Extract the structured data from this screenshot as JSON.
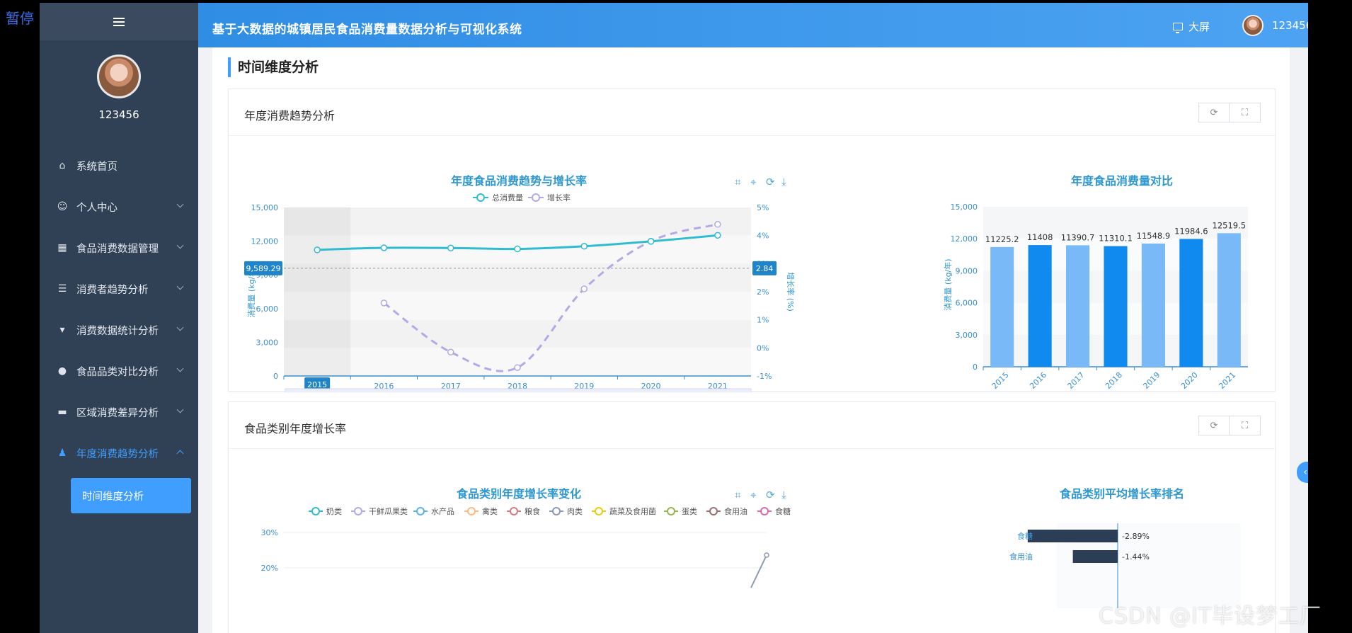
{
  "overlay": {
    "pause_label": "暂停",
    "watermark": "CSDN @IT毕设梦工厂"
  },
  "user": {
    "name": "123456"
  },
  "sidebar": {
    "items": [
      {
        "label": "系统首页",
        "icon": "home-icon",
        "has_children": false
      },
      {
        "label": "个人中心",
        "icon": "user-icon",
        "has_children": true
      },
      {
        "label": "食品消费数据管理",
        "icon": "grid-icon",
        "has_children": true
      },
      {
        "label": "消费者趋势分析",
        "icon": "list-icon",
        "has_children": true
      },
      {
        "label": "消费数据统计分析",
        "icon": "brush-icon",
        "has_children": true
      },
      {
        "label": "食品品类对比分析",
        "icon": "bulb-icon",
        "has_children": true
      },
      {
        "label": "区域消费差异分析",
        "icon": "monitor-icon",
        "has_children": true
      },
      {
        "label": "年度消费趋势分析",
        "icon": "person-icon",
        "has_children": true,
        "expanded": true
      }
    ],
    "submenu": {
      "label": "时间维度分析"
    }
  },
  "header": {
    "title": "基于大数据的城镇居民食品消费量数据分析与可视化系统",
    "bigscreen_label": "大屏"
  },
  "page": {
    "title": "时间维度分析"
  },
  "cards": [
    {
      "title": "年度消费趋势分析"
    },
    {
      "title": "食品类别年度增长率"
    }
  ],
  "colors": {
    "header": "#3a97ea",
    "sidebar": "#304156",
    "accent": "#409eff",
    "line_total": "#2fbcd3",
    "line_growth": "#b5a8e6",
    "bar_dark": "#118af0",
    "bar_light": "#79b9f7"
  },
  "chart_data": [
    {
      "type": "line",
      "title": "年度食品消费趋势与增长率",
      "x": [
        "2015",
        "2016",
        "2017",
        "2018",
        "2019",
        "2020",
        "2021"
      ],
      "series": [
        {
          "name": "总消费量",
          "axis": "left",
          "values": [
            11225.2,
            11408,
            11390.7,
            11310.1,
            11548.9,
            11984.6,
            12519.5
          ]
        },
        {
          "name": "增长率",
          "axis": "right",
          "values": [
            null,
            1.6,
            -0.15,
            -0.7,
            2.1,
            3.8,
            4.4
          ]
        }
      ],
      "ylabel": "消费量 (kg/年)",
      "ylabel_right": "增长率 (%)",
      "ylim": [
        0,
        15000
      ],
      "yticks": [
        "0",
        "3,000",
        "6,000",
        "9,000",
        "12,000",
        "15,000"
      ],
      "ylim_right": [
        -1,
        5
      ],
      "yticks_right": [
        "-1%",
        "0%",
        "1%",
        "2%",
        "3%",
        "4%",
        "5%"
      ],
      "crosshair": {
        "x_label": "2015",
        "y_left_label": "9,589.29",
        "y_right_label": "2.84"
      },
      "legend": "top",
      "grid": true
    },
    {
      "type": "bar",
      "title": "年度食品消费量对比",
      "categories": [
        "2015",
        "2016",
        "2017",
        "2018",
        "2019",
        "2020",
        "2021"
      ],
      "values": [
        11225.2,
        11408,
        11390.7,
        11310.1,
        11548.9,
        11984.6,
        12519.5
      ],
      "value_labels": [
        "11225.2",
        "11408",
        "11390.7",
        "11310.1",
        "11548.9",
        "11984.6",
        "12519.5"
      ],
      "ylabel": "消费量 (kg/年)",
      "ylim": [
        0,
        15000
      ],
      "yticks": [
        "0",
        "3,000",
        "6,000",
        "9,000",
        "12,000",
        "15,000"
      ],
      "grid": true
    },
    {
      "type": "line",
      "title": "食品类别年度增长率变化",
      "legend_entries": [
        {
          "name": "奶类",
          "color": "#2fbcd3"
        },
        {
          "name": "干鲜瓜果类",
          "color": "#b5a8e6"
        },
        {
          "name": "水产品",
          "color": "#5ab1ef"
        },
        {
          "name": "禽类",
          "color": "#ffb980"
        },
        {
          "name": "粮食",
          "color": "#d87a80"
        },
        {
          "name": "肉类",
          "color": "#8d98b3"
        },
        {
          "name": "蔬菜及食用菌",
          "color": "#e5cf0d"
        },
        {
          "name": "蛋类",
          "color": "#97b552"
        },
        {
          "name": "食用油",
          "color": "#95706d"
        },
        {
          "name": "食糖",
          "color": "#dc69aa"
        }
      ],
      "yticks": [
        "30%",
        "20%"
      ],
      "legend": "top"
    },
    {
      "type": "bar",
      "title": "食品类别平均增长率排名",
      "categories": [
        "食糖",
        "食用油"
      ],
      "values": [
        -2.89,
        -1.44
      ],
      "value_labels": [
        "-2.89%",
        "-1.44%"
      ]
    }
  ]
}
